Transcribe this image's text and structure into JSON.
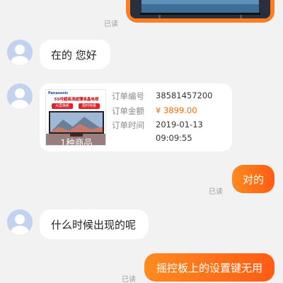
{
  "colors": {
    "background": "#f2f2f2",
    "accent": "#ff6a00",
    "bubble_left": "#ffffff",
    "read_text": "#9a9a9a"
  },
  "messages": {
    "top_image_read": "已读",
    "greeting": "在的 您好",
    "order": {
      "product_brand": "Panasonic",
      "product_title": "55吋超高清超薄液晶电视",
      "promo_left": "大屏焕新",
      "promo_right": "限时特惠",
      "product_count": "1种商品",
      "fields": [
        {
          "label": "订单编号",
          "value": "38581457200"
        },
        {
          "label": "订单金额",
          "value": "¥ 3899.00"
        },
        {
          "label": "订单时间",
          "value": "2019-01-13"
        },
        {
          "label": "",
          "value": "09:09:55"
        }
      ]
    },
    "right_1": "对的",
    "right_1_read": "已读",
    "question": "什么时候出现的呢",
    "right_2": "摇控板上的设置键无用",
    "right_2_read": "已读"
  },
  "icons": {
    "avatar": "default-user-avatar-icon"
  }
}
